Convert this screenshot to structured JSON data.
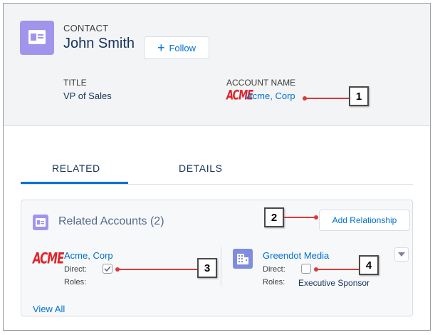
{
  "header": {
    "object_type": "CONTACT",
    "record_name": "John Smith",
    "follow_label": "Follow",
    "fields": [
      {
        "label": "TITLE",
        "value": "VP of Sales"
      },
      {
        "label": "ACCOUNT NAME",
        "value": "Acme, Corp",
        "logo_text": "ACME"
      }
    ]
  },
  "tabs": [
    {
      "label": "RELATED",
      "active": true
    },
    {
      "label": "DETAILS",
      "active": false
    }
  ],
  "related_accounts": {
    "title": "Related Accounts (2)",
    "add_button_label": "Add Relationship",
    "view_all_label": "View All",
    "accounts": [
      {
        "name": "Acme, Corp",
        "logo_text": "ACME",
        "direct_label": "Direct:",
        "direct": true,
        "roles_label": "Roles:",
        "roles": ""
      },
      {
        "name": "Greendot Media",
        "direct_label": "Direct:",
        "direct": false,
        "roles_label": "Roles:",
        "roles": "Executive Sponsor"
      }
    ]
  },
  "callouts": [
    "1",
    "2",
    "3",
    "4"
  ],
  "colors": {
    "link": "#0070d2",
    "contact_icon": "#a094ed",
    "account_icon": "#7f8de1",
    "active_tab": "#0070d2",
    "callout_line": "#d63b3b",
    "acme_logo": "#e0232b"
  },
  "icons": {
    "contact": "contact-card-icon",
    "account": "building-icon",
    "follow": "plus-icon",
    "menu": "chevron-down-icon"
  }
}
